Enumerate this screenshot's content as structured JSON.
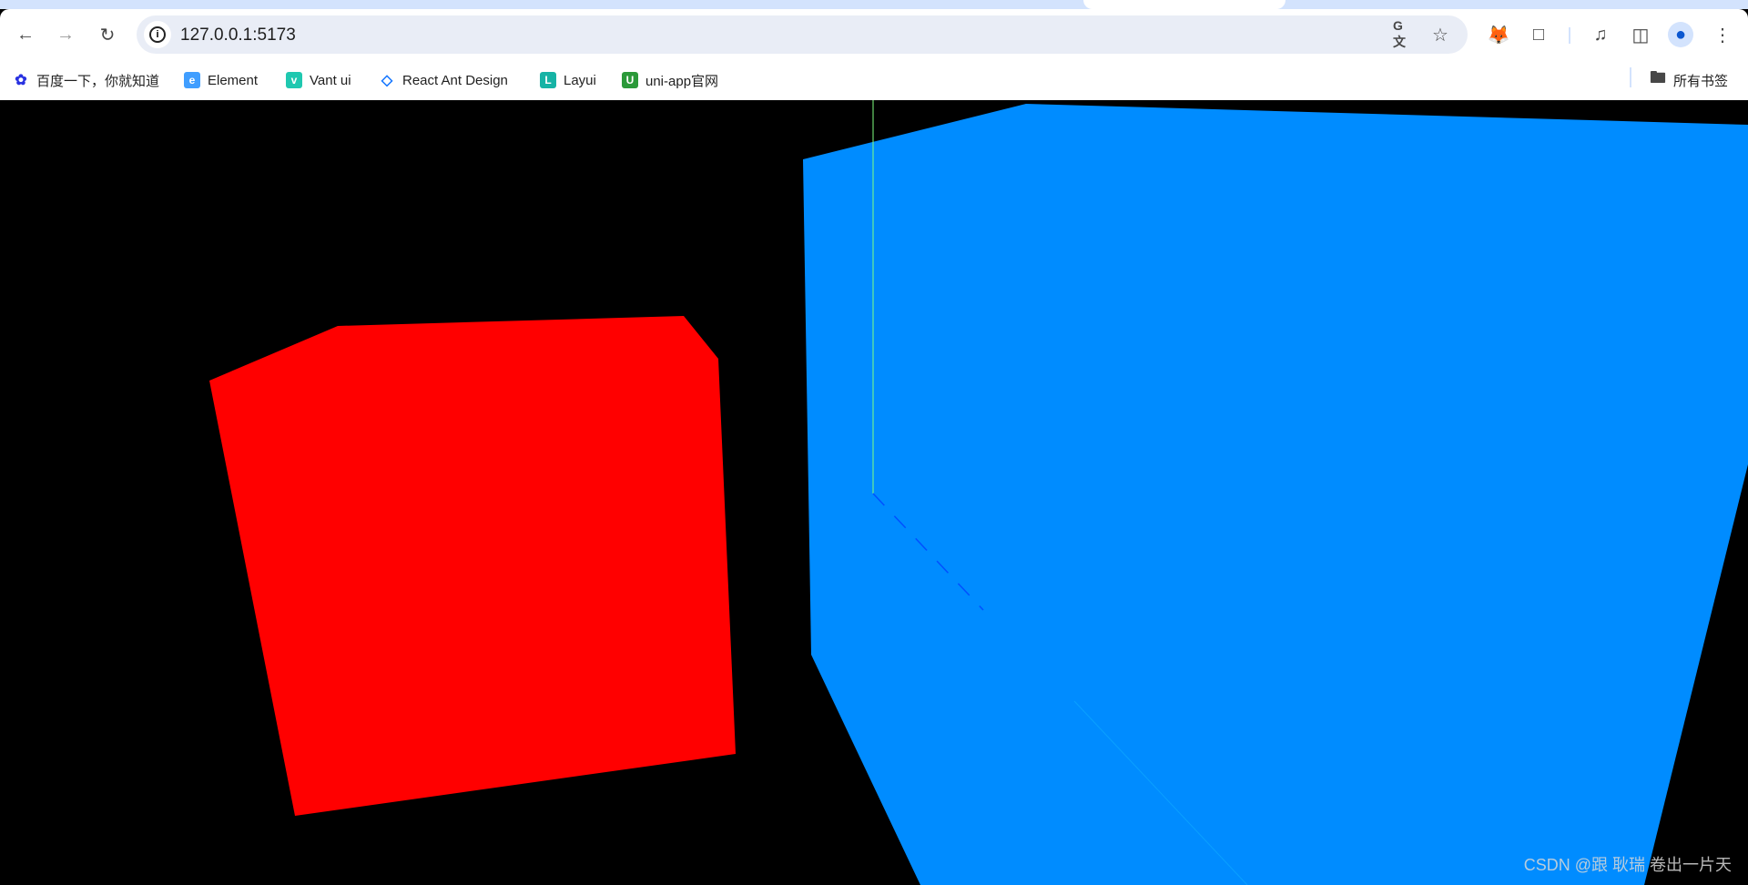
{
  "browser": {
    "url": "127.0.0.1:5173",
    "bookmarks": [
      {
        "label": "百度一下，你就知道",
        "icon": "baidu-icon",
        "color": "#2932e1"
      },
      {
        "label": "Element",
        "icon": "element-icon",
        "color": "#409eff"
      },
      {
        "label": "Vant ui",
        "icon": "vant-icon",
        "color": "#07c160"
      },
      {
        "label": "React Ant Design",
        "icon": "ant-design-icon",
        "color": "#1677ff"
      },
      {
        "label": "Layui",
        "icon": "layui-icon",
        "color": "#16b3a5"
      },
      {
        "label": "uni-app官网",
        "icon": "uniapp-icon",
        "color": "#2b9939"
      }
    ],
    "all_bookmarks_label": "所有书签"
  },
  "scene": {
    "background": "#000000",
    "red_cube_color": "#ff0000",
    "blue_cube_color": "#008cff",
    "axis_color": "#7fff7f"
  },
  "watermark": "CSDN @跟 耿瑞 卷出一片天"
}
